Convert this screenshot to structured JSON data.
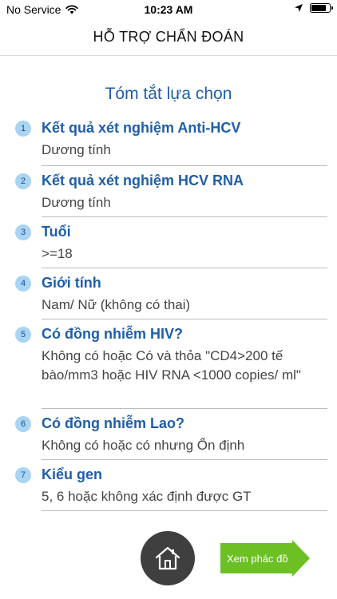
{
  "status": {
    "carrier": "No Service",
    "time": "10:23 AM",
    "battery_level": 0.85
  },
  "header": {
    "title": "HỖ TRỢ CHẨN ĐOÁN"
  },
  "summary": {
    "title": "Tóm tắt lựa chọn",
    "items": [
      {
        "number": "1",
        "label": "Kết quả xét nghiệm Anti-HCV",
        "value": "Dương tính"
      },
      {
        "number": "2",
        "label": "Kết quả xét nghiệm HCV RNA",
        "value": "Dương tính"
      },
      {
        "number": "3",
        "label": "Tuổi",
        "value": ">=18"
      },
      {
        "number": "4",
        "label": "Giới tính",
        "value": "Nam/ Nữ (không có thai)"
      },
      {
        "number": "5",
        "label": "Có đồng nhiễm HIV?",
        "value": "Không có hoặc Có và thỏa \"CD4>200 tế bào/mm3 hoặc HIV RNA <1000 copies/ ml\""
      },
      {
        "number": "6",
        "label": "Có đồng nhiễm Lao?",
        "value": "Không có hoặc có nhưng Ổn định"
      },
      {
        "number": "7",
        "label": "Kiểu gen",
        "value": "5, 6 hoặc không xác định được GT"
      }
    ]
  },
  "footer": {
    "next_label": "Xem phác đồ"
  },
  "colors": {
    "accent": "#1f5ea8",
    "badge": "#a9d4f3",
    "next_button": "#6cc024",
    "home_button": "#3f3f3f"
  },
  "icons": {
    "wifi": "wifi-icon",
    "location": "location-arrow-icon",
    "battery": "battery-icon",
    "home": "home-icon",
    "next": "arrow-right-icon"
  }
}
